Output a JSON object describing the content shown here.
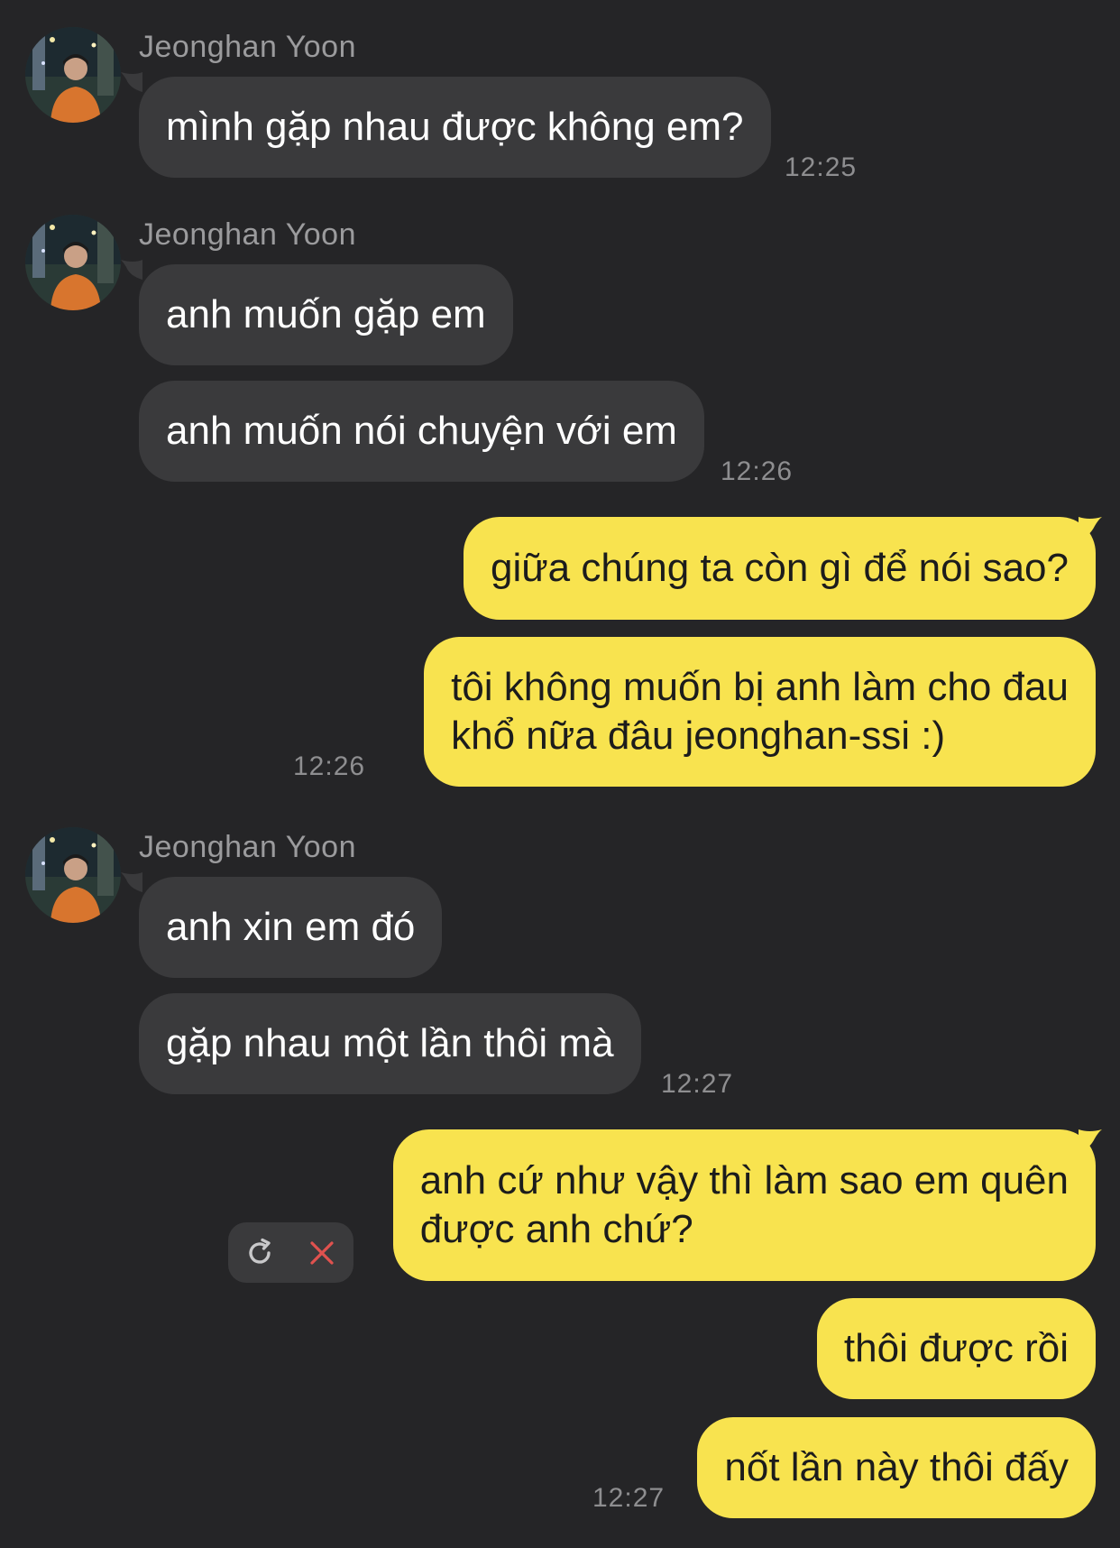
{
  "messages": [
    {
      "sender": "Jeonghan Yoon",
      "texts": [
        "mình gặp nhau được không em?"
      ],
      "time": "12:25"
    },
    {
      "sender": "Jeonghan Yoon",
      "texts": [
        "anh muốn gặp em",
        "anh muốn nói chuyện với em"
      ],
      "time": "12:26"
    },
    {
      "texts": [
        "giữa chúng ta còn gì để nói sao?",
        "tôi không muốn bị anh làm cho đau\nkhổ nữa đâu jeonghan-ssi :)"
      ],
      "time": "12:26"
    },
    {
      "sender": "Jeonghan Yoon",
      "texts": [
        "anh xin em đó",
        "gặp nhau một lần thôi mà"
      ],
      "time": "12:27"
    },
    {
      "texts": [
        "anh cứ như vậy thì làm sao em quên\nđược anh chứ?",
        "thôi được rồi",
        "nốt lần này thôi đấy"
      ],
      "time": "12:27"
    }
  ],
  "icons": {
    "retry": "refresh-icon",
    "delete": "close-icon"
  },
  "colors": {
    "background": "#252527",
    "incoming_bubble": "#3a3a3c",
    "outgoing_bubble": "#f8e34f",
    "delete_icon": "#e0524f"
  }
}
